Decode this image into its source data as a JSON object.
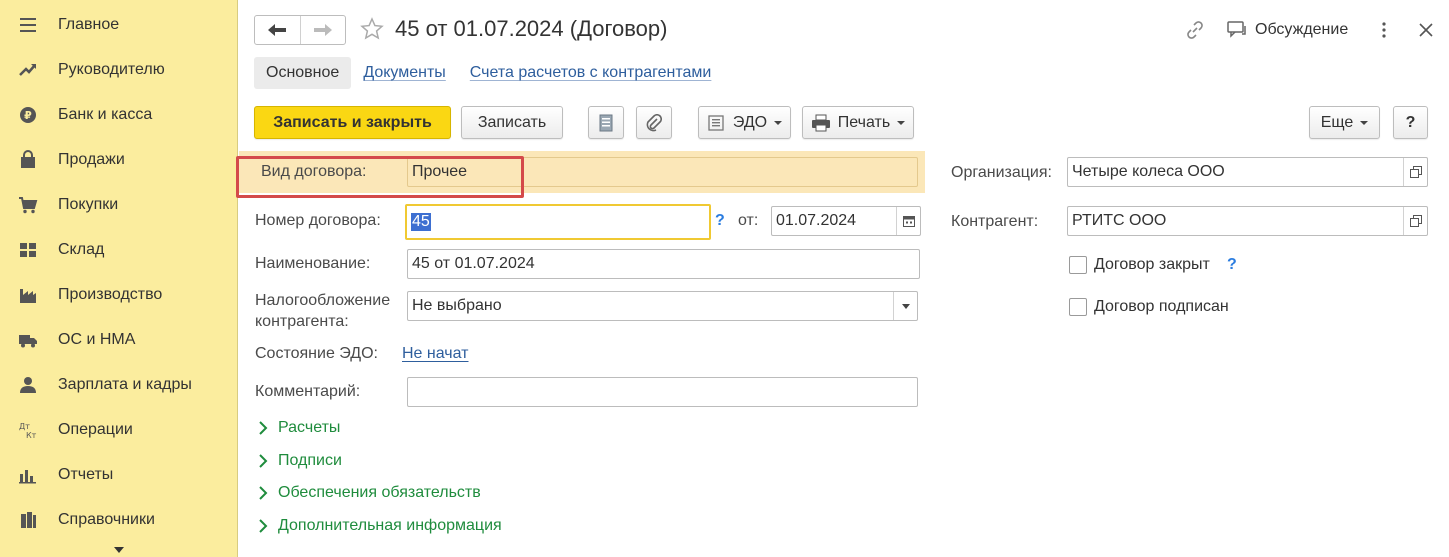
{
  "sidebar": {
    "items": [
      {
        "label": "Главное",
        "icon": "menu-icon"
      },
      {
        "label": "Руководителю",
        "icon": "trend-icon"
      },
      {
        "label": "Банк и касса",
        "icon": "ruble-coin-icon"
      },
      {
        "label": "Продажи",
        "icon": "shopping-bag-icon"
      },
      {
        "label": "Покупки",
        "icon": "cart-icon"
      },
      {
        "label": "Склад",
        "icon": "warehouse-grid-icon"
      },
      {
        "label": "Производство",
        "icon": "factory-icon"
      },
      {
        "label": "ОС и НМА",
        "icon": "truck-icon"
      },
      {
        "label": "Зарплата и кадры",
        "icon": "person-icon"
      },
      {
        "label": "Операции",
        "icon": "dt-kt-icon"
      },
      {
        "label": "Отчеты",
        "icon": "bar-chart-icon"
      },
      {
        "label": "Справочники",
        "icon": "books-icon"
      }
    ],
    "icon_text": {
      "dt": "Дт",
      "kt": "Кт"
    }
  },
  "header": {
    "title": "45 от 01.07.2024 (Договор)",
    "discussion": "Обсуждение"
  },
  "tabs": [
    {
      "label": "Основное"
    },
    {
      "label": "Документы"
    },
    {
      "label": "Счета расчетов с контрагентами"
    }
  ],
  "toolbar": {
    "save_close": "Записать и закрыть",
    "save": "Записать",
    "edo": "ЭДО",
    "print": "Печать",
    "more": "Еще",
    "help": "?"
  },
  "form": {
    "contract_type_label": "Вид договора:",
    "contract_type_value": "Прочее",
    "number_label": "Номер договора:",
    "number_value": "45",
    "number_help": "?",
    "from_label": "от:",
    "date_value": "01.07.2024",
    "name_label": "Наименование:",
    "name_value": "45 от 01.07.2024",
    "tax_label_line1": "Налогообложение",
    "tax_label_line2": "контрагента:",
    "tax_value": "Не выбрано",
    "edo_state_label": "Состояние ЭДО:",
    "edo_state_value": "Не начат",
    "comment_label": "Комментарий:",
    "comment_value": "",
    "org_label": "Организация:",
    "org_value": "Четыре колеса ООО",
    "counterparty_label": "Контрагент:",
    "counterparty_value": "РТИТС ООО",
    "closed_label": "Договор закрыт",
    "closed_help": "?",
    "signed_label": "Договор подписан"
  },
  "groups": [
    {
      "label": "Расчеты"
    },
    {
      "label": "Подписи"
    },
    {
      "label": "Обеспечения обязательств"
    },
    {
      "label": "Дополнительная информация"
    }
  ],
  "colors": {
    "sidebar_bg": "#fbed9e",
    "primary_button": "#fad713",
    "link": "#2e5e9d",
    "group_green": "#1f8c3d",
    "highlight": "#fbe7b8",
    "red_frame": "#d44a4a"
  }
}
